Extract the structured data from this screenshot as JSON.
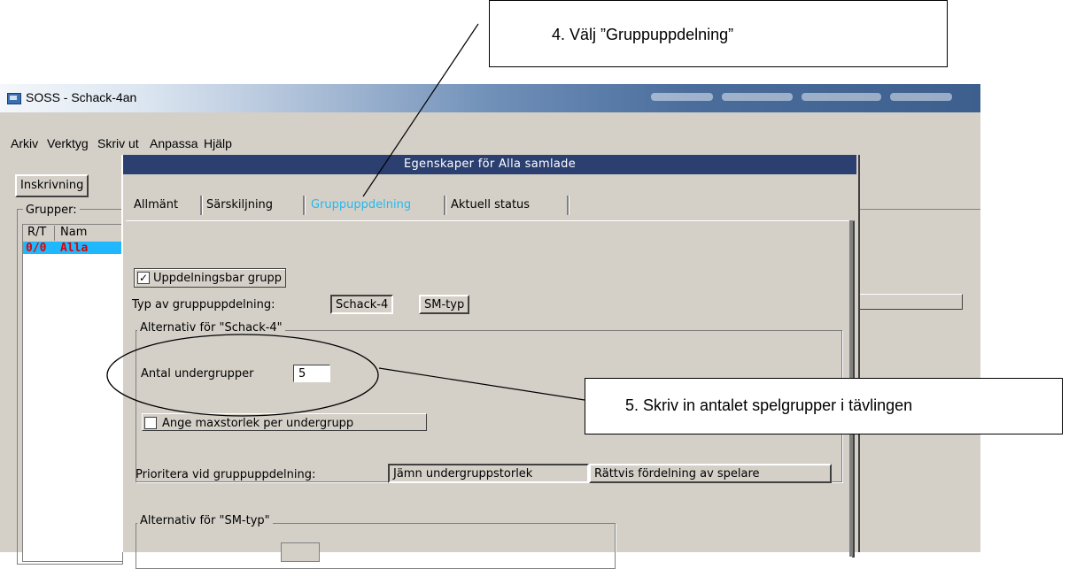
{
  "app": {
    "title": "SOSS - Schack-4an",
    "menu": [
      "Arkiv",
      "Verktyg",
      "Skriv ut",
      "Anpassa",
      "Hjälp"
    ],
    "tab_inskrivning": "Inskrivning",
    "groups_label": "Grupper:",
    "groups_columns": [
      "R/T",
      "Nam"
    ],
    "group_row": {
      "rt": "0/0",
      "name": "Alla"
    }
  },
  "dialog": {
    "title": "Egenskaper för Alla samlade",
    "tabs": [
      "Allmänt",
      "Särskiljning",
      "Gruppuppdelning",
      "Aktuell status"
    ],
    "active_tab": "Gruppuppdelning",
    "checkbox_split": {
      "label": "Uppdelningsbar grupp",
      "checked": true
    },
    "type_label": "Typ av gruppuppdelning:",
    "type_options": [
      "Schack-4",
      "SM-typ"
    ],
    "type_selected": "Schack-4",
    "schack4_group": {
      "label": "Alternativ för \"Schack-4\"",
      "subgroups_label": "Antal undergrupper",
      "subgroups_value": "5",
      "max_size": {
        "label": "Ange maxstorlek per undergrupp",
        "checked": false
      },
      "priority_label": "Prioritera vid gruppuppdelning:",
      "priority_options": [
        "Jämn undergruppstorlek",
        "Rättvis fördelning av spelare"
      ],
      "priority_selected": "Jämn undergruppstorlek"
    },
    "sm_group": {
      "label": "Alternativ för \"SM-typ\""
    }
  },
  "annotations": {
    "callout4": "4.   Välj ”Gruppuppdelning”",
    "callout5": "5.    Skriv in antalet spelgrupper i tävlingen"
  },
  "colors": {
    "dialog_titlebar": "#2b3f70",
    "active_tab_text": "#26b8ec",
    "group_row_bg": "#1fb8ff",
    "group_row_text": "#e00000"
  }
}
